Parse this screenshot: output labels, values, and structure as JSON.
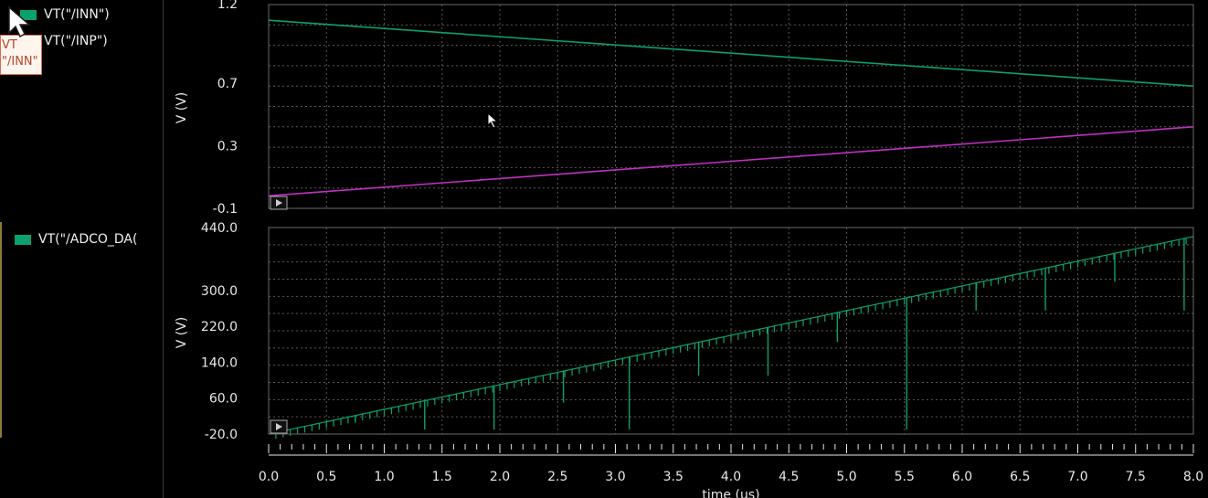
{
  "legend": {
    "top": [
      {
        "label": "VT(\"/INN\")",
        "color": "#0aa070"
      },
      {
        "label": "VT(\"/INP\")",
        "color": "#c030c0"
      }
    ],
    "bottom": [
      {
        "label": "VT(\"/ADCO_DA(",
        "color": "#0aa070"
      }
    ],
    "tooltip": {
      "line1": "VT",
      "line2": "\"/INN\""
    }
  },
  "colors": {
    "inn": "#0aa070",
    "inp": "#c030c0",
    "adc": "#0aa070",
    "grid": "#5a5a5a",
    "background": "#000000"
  },
  "chart_data": [
    {
      "type": "line",
      "ylabel": "V (V)",
      "yticks": [
        "1.2",
        "0.7",
        "0.3",
        "-0.1"
      ],
      "ylim": [
        -0.1,
        1.2
      ],
      "xlim": [
        0,
        8.0
      ],
      "grid": true,
      "series": [
        {
          "name": "VT(\"/INN\")",
          "x": [
            0.0,
            8.0
          ],
          "y": [
            1.1,
            0.68
          ]
        },
        {
          "name": "VT(\"/INP\")",
          "x": [
            0.0,
            8.0
          ],
          "y": [
            -0.02,
            0.42
          ]
        }
      ]
    },
    {
      "type": "line",
      "ylabel": "V (V)",
      "yticks": [
        "440.0",
        "300.0",
        "220.0",
        "140.0",
        "60.0",
        "-20.0"
      ],
      "ylim": [
        -20,
        440
      ],
      "xlim": [
        0,
        8.0
      ],
      "grid": true,
      "xlabel": "time (us)",
      "xticks": [
        "0.0",
        "0.5",
        "1.0",
        "1.5",
        "2.0",
        "2.5",
        "3.0",
        "3.5",
        "4.0",
        "4.5",
        "5.0",
        "5.5",
        "6.0",
        "6.5",
        "7.0",
        "7.5",
        "8.0"
      ],
      "series": [
        {
          "name": "VT(\"/ADCO_DA(",
          "x": [
            0.0,
            8.0
          ],
          "y": [
            -20,
            420
          ],
          "glitches": [
            {
              "x": 0.75,
              "y": 5
            },
            {
              "x": 1.35,
              "y": -10
            },
            {
              "x": 1.95,
              "y": -10
            },
            {
              "x": 2.55,
              "y": 50
            },
            {
              "x": 3.12,
              "y": -10
            },
            {
              "x": 3.72,
              "y": 110
            },
            {
              "x": 4.32,
              "y": 110
            },
            {
              "x": 4.92,
              "y": 185
            },
            {
              "x": 5.52,
              "y": -10
            },
            {
              "x": 6.12,
              "y": 255
            },
            {
              "x": 6.72,
              "y": 255
            },
            {
              "x": 7.32,
              "y": 320
            },
            {
              "x": 7.92,
              "y": 255
            }
          ]
        }
      ]
    }
  ]
}
